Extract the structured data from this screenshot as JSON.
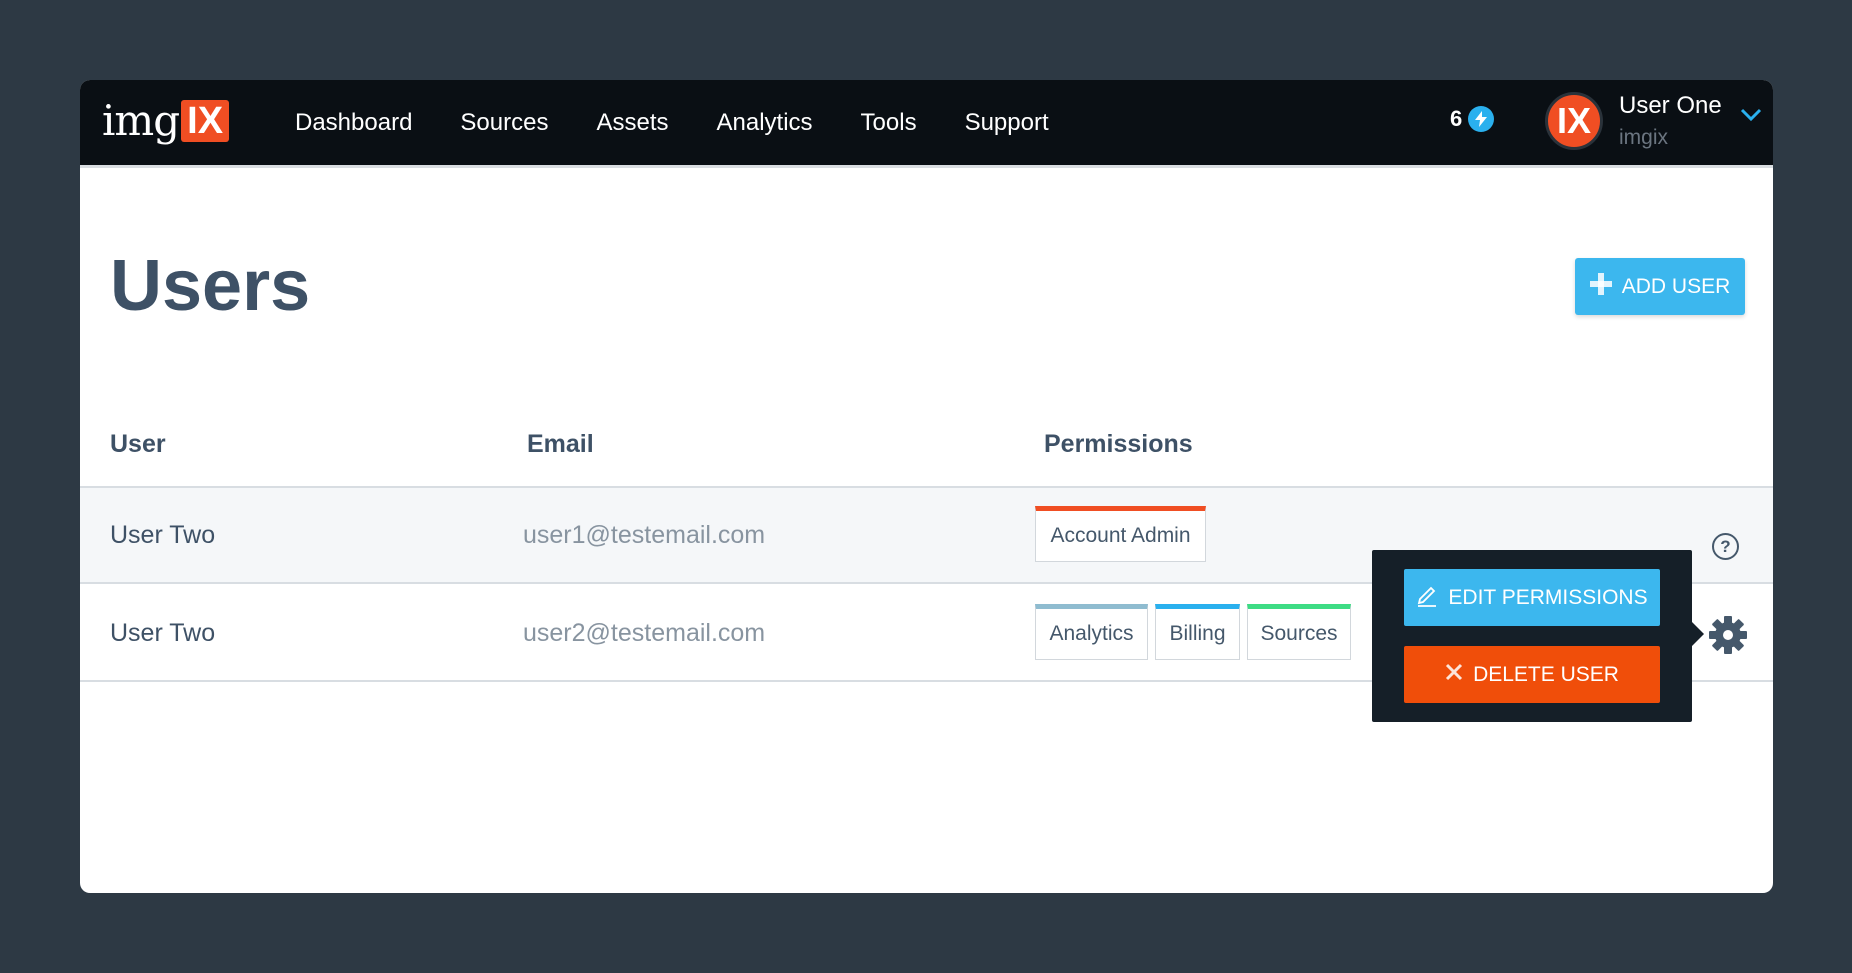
{
  "brand": {
    "logo_text": "img",
    "logo_box": "IX"
  },
  "nav": {
    "items": [
      {
        "label": "Dashboard"
      },
      {
        "label": "Sources"
      },
      {
        "label": "Assets"
      },
      {
        "label": "Analytics"
      },
      {
        "label": "Tools"
      },
      {
        "label": "Support"
      }
    ]
  },
  "credits": {
    "count": "6"
  },
  "account": {
    "name": "User One",
    "org": "imgix",
    "avatar_text": "IX"
  },
  "page": {
    "title": "Users",
    "add_user_label": "ADD USER"
  },
  "table": {
    "headers": {
      "user": "User",
      "email": "Email",
      "permissions": "Permissions"
    },
    "rows": [
      {
        "user": "User Two",
        "email": "user1@testemail.com",
        "permissions": [
          {
            "label": "Account Admin",
            "color": "#f04e23"
          }
        ]
      },
      {
        "user": "User Two",
        "email": "user2@testemail.com",
        "permissions": [
          {
            "label": "Analytics",
            "color": "#8fbcd0"
          },
          {
            "label": "Billing",
            "color": "#2ab0ee"
          },
          {
            "label": "Sources",
            "color": "#3ddc84"
          }
        ]
      }
    ]
  },
  "popover": {
    "edit_label": "EDIT PERMISSIONS",
    "delete_label": "DELETE USER"
  },
  "colors": {
    "accent": "#3cb7ee",
    "danger": "#f04e0a",
    "brand": "#f04e23",
    "nav_bg": "#0a0f14",
    "page_bg": "#2d3944"
  },
  "icons": {
    "credits": "bolt-icon",
    "account_menu": "chevron-down-icon",
    "add": "plus-icon",
    "help": "question-circle-icon",
    "row_menu": "gear-icon",
    "edit": "pencil-icon",
    "delete": "close-icon"
  }
}
